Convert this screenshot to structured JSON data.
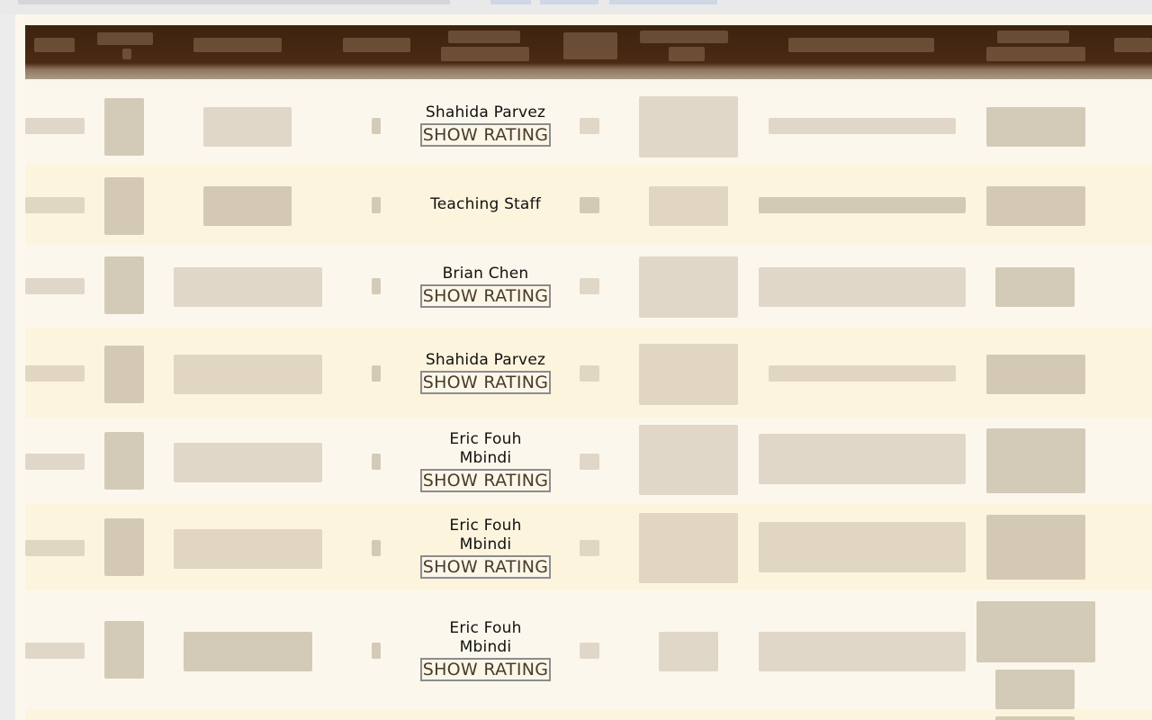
{
  "table": {
    "rows": [
      {
        "instructor": "Shahida Parvez",
        "button": "SHOW RATING"
      },
      {
        "instructor": "Teaching Staff",
        "button": ""
      },
      {
        "instructor": "Brian Chen",
        "button": "SHOW RATING"
      },
      {
        "instructor": "Shahida Parvez",
        "button": "SHOW RATING"
      },
      {
        "instructor": "Eric Fouh\nMbindi",
        "button": "SHOW RATING"
      },
      {
        "instructor": "Eric Fouh\nMbindi",
        "button": "SHOW RATING"
      },
      {
        "instructor": "Eric Fouh\nMbindi",
        "button": "SHOW RATING"
      }
    ]
  },
  "colors": {
    "header_bg": "#4a2a12",
    "row_even": "#fcf7ec",
    "row_odd": "#fdf4de",
    "button_text": "#4b3b26"
  }
}
